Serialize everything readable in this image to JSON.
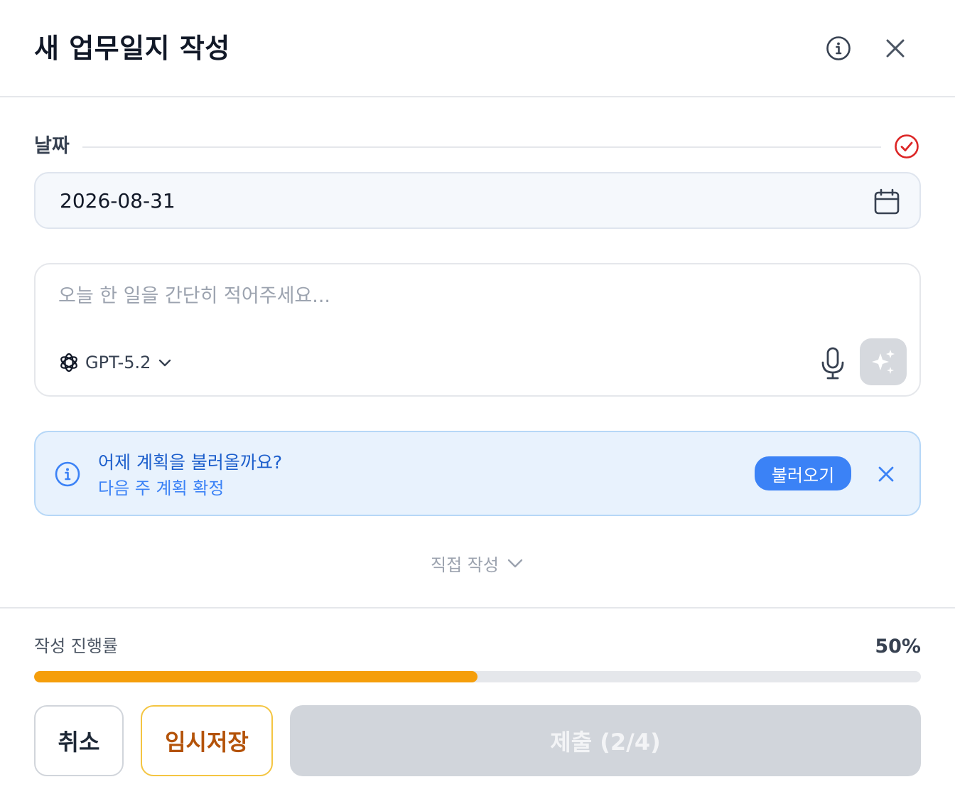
{
  "header": {
    "title": "새 업무일지 작성"
  },
  "date": {
    "label": "날짜",
    "value": "2026-08-31"
  },
  "compose": {
    "placeholder": "오늘 한 일을 간단히 적어주세요...",
    "model": "GPT-5.2"
  },
  "banner": {
    "title": "어제 계획을 불러올까요?",
    "subtitle": "다음 주 계획 확정",
    "action_label": "불러오기"
  },
  "direct_write": {
    "label": "직접 작성"
  },
  "progress": {
    "label": "작성 진행률",
    "percent_text": "50%",
    "value": 0.5
  },
  "actions": {
    "cancel_label": "취소",
    "draft_label": "임시저장",
    "submit_label": "제출 (2/4)"
  },
  "colors": {
    "accent": "#3b82f6",
    "progress": "#f59e0b",
    "required": "#dc2626",
    "draft_border": "#f4c542",
    "draft_text": "#b45309"
  }
}
